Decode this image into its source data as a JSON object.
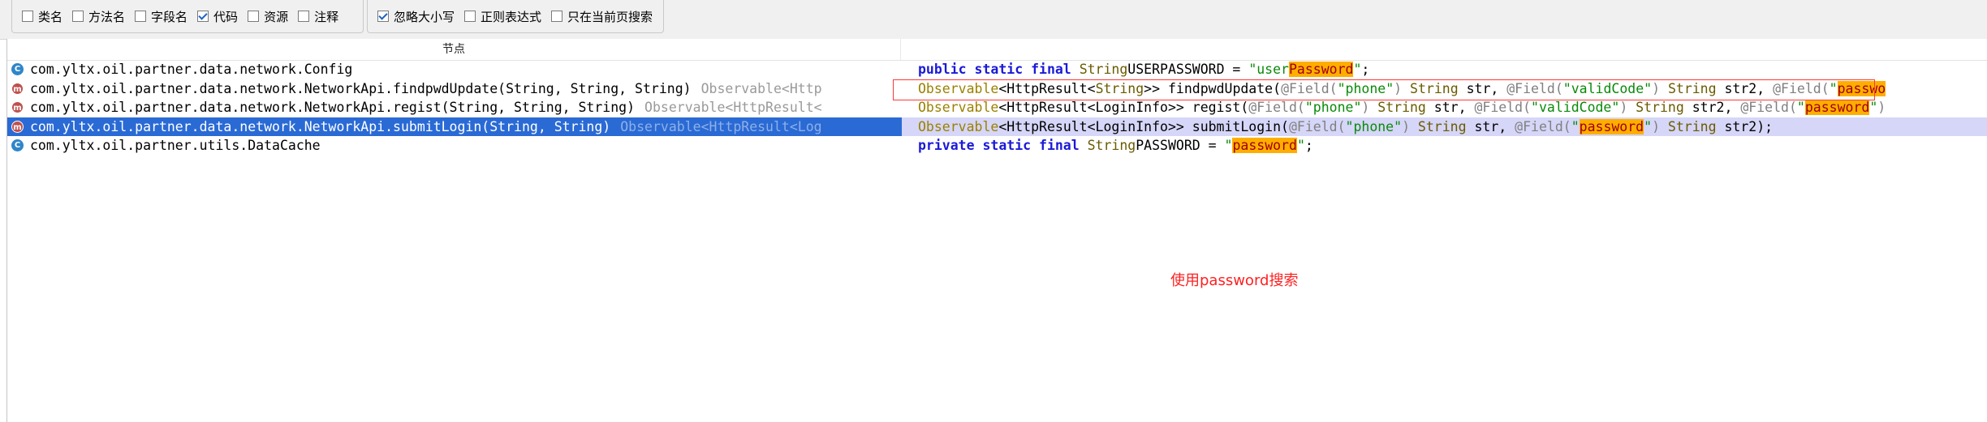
{
  "toolbar": {
    "filters": [
      {
        "label": "类名",
        "checked": false
      },
      {
        "label": "方法名",
        "checked": false
      },
      {
        "label": "字段名",
        "checked": false
      },
      {
        "label": "代码",
        "checked": true
      },
      {
        "label": "资源",
        "checked": false
      },
      {
        "label": "注释",
        "checked": false
      }
    ],
    "options": [
      {
        "label": "忽略大小写",
        "checked": true
      },
      {
        "label": "正则表达式",
        "checked": false
      },
      {
        "label": "只在当前页搜索",
        "checked": false
      }
    ]
  },
  "table": {
    "header": "节点",
    "rows": [
      {
        "icon": "class-icon",
        "node": "com.yltx.oil.partner.data.network.Config",
        "ret": "",
        "selected": false,
        "code": [
          [
            "kw",
            "public static final "
          ],
          [
            "ty",
            "String"
          ],
          [
            "",
            "USERPASSWORD = "
          ],
          [
            "st",
            "\"user"
          ],
          [
            "hl",
            "Password"
          ],
          [
            "st",
            "\""
          ],
          [
            "",
            ";"
          ]
        ]
      },
      {
        "icon": "method-icon",
        "node": "com.yltx.oil.partner.data.network.NetworkApi.findpwdUpdate(String, String, String)",
        "ret": "Observable<Http",
        "selected": false,
        "code": [
          [
            "ty2",
            "Observable"
          ],
          [
            "",
            "<HttpResult<"
          ],
          [
            "ty",
            "String"
          ],
          [
            "",
            ">> findpwdUpdate("
          ],
          [
            "an",
            "@Field("
          ],
          [
            "st",
            "\"phone\""
          ],
          [
            "an",
            ")"
          ],
          [
            "ty",
            " String"
          ],
          [
            "",
            " str, "
          ],
          [
            "an",
            "@Field("
          ],
          [
            "st",
            "\"validCode\""
          ],
          [
            "an",
            ")"
          ],
          [
            "ty",
            " String"
          ],
          [
            "",
            " str2, "
          ],
          [
            "an",
            "@Field("
          ],
          [
            "st",
            "\""
          ],
          [
            "hl",
            "passwo"
          ]
        ]
      },
      {
        "icon": "method-icon",
        "node": "com.yltx.oil.partner.data.network.NetworkApi.regist(String, String, String)",
        "ret": "Observable<HttpResult<",
        "selected": false,
        "code": [
          [
            "ty2",
            "Observable"
          ],
          [
            "",
            "<HttpResult<LoginInfo>> regist("
          ],
          [
            "an",
            "@Field("
          ],
          [
            "st",
            "\"phone\""
          ],
          [
            "an",
            ")"
          ],
          [
            "ty",
            " String"
          ],
          [
            "",
            " str, "
          ],
          [
            "an",
            "@Field("
          ],
          [
            "st",
            "\"validCode\""
          ],
          [
            "an",
            ")"
          ],
          [
            "ty",
            " String"
          ],
          [
            "",
            " str2, "
          ],
          [
            "an",
            "@Field("
          ],
          [
            "st",
            "\""
          ],
          [
            "hl",
            "password"
          ],
          [
            "st",
            "\""
          ],
          [
            "an",
            ")"
          ]
        ]
      },
      {
        "icon": "method-icon",
        "node": "com.yltx.oil.partner.data.network.NetworkApi.submitLogin(String, String)",
        "ret": "Observable<HttpResult<Log",
        "selected": true,
        "code": [
          [
            "ty2",
            "Observable"
          ],
          [
            "",
            "<HttpResult<LoginInfo>> submitLogin("
          ],
          [
            "an",
            "@Field("
          ],
          [
            "st",
            "\"phone\""
          ],
          [
            "an",
            ")"
          ],
          [
            "ty",
            " String"
          ],
          [
            "",
            " str, "
          ],
          [
            "an",
            "@Field("
          ],
          [
            "st",
            "\""
          ],
          [
            "hl",
            "password"
          ],
          [
            "st",
            "\""
          ],
          [
            "an",
            ")"
          ],
          [
            "ty",
            " String"
          ],
          [
            "",
            " str2);"
          ]
        ]
      },
      {
        "icon": "class-icon",
        "node": "com.yltx.oil.partner.utils.DataCache",
        "ret": "",
        "selected": false,
        "code": [
          [
            "kw",
            "private static final "
          ],
          [
            "ty",
            "String"
          ],
          [
            "",
            "PASSWORD = "
          ],
          [
            "st",
            "\""
          ],
          [
            "hl",
            "password"
          ],
          [
            "st",
            "\""
          ],
          [
            "",
            ";"
          ]
        ]
      }
    ]
  },
  "annotation": "使用password搜索",
  "colors": {
    "selection": "#2a6ad5",
    "highlight": "#ffae00",
    "annotation": "#ff2020"
  }
}
